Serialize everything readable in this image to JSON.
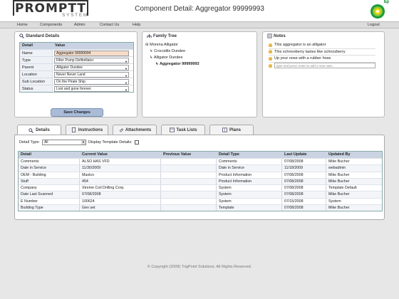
{
  "header": {
    "logo_main": "PROMPTT",
    "logo_sub": "SYSTEM",
    "title": "Component Detail: Aggregator 99999993",
    "brand": "bp",
    "colors": {
      "brand_green": "#1a9b3a",
      "brand_yellow": "#f5d400",
      "accent": "#c9d3e2"
    }
  },
  "nav": {
    "items": [
      "Home",
      "Components",
      "Admin",
      "Contact Us",
      "Help"
    ],
    "logout": "Logout"
  },
  "standard_details": {
    "title": "Standard Details",
    "col_detail": "Detail",
    "col_value": "Value",
    "rows": [
      {
        "label": "Name",
        "value": "Aggregator 99999994"
      },
      {
        "label": "Type",
        "value": "Filter Pump Defibrillator"
      },
      {
        "label": "Parent",
        "value": "Alligator Dundee"
      },
      {
        "label": "Location",
        "value": "Never Never Land"
      },
      {
        "label": "Sub Location",
        "value": "On the Pirate Ship"
      },
      {
        "label": "Status",
        "value": "Lost and gone forever."
      }
    ],
    "save_label": "Save Changes"
  },
  "family_tree": {
    "title": "Family Tree",
    "nodes": [
      "Morena Alligator",
      "Crocodile Dundee",
      "Alligator Dundee",
      "Aggregator 99999993"
    ]
  },
  "notes": {
    "title": "Notes",
    "items": [
      "This aggregator is an alligator",
      "This schnooberry tastes like schnozberry",
      "Up your nose with a rubber hose"
    ],
    "input_placeholder": "type and press enter to add a new note..."
  },
  "tabs": [
    "Details",
    "Instructions",
    "Attachments",
    "Task Lists",
    "Plans"
  ],
  "filter": {
    "label": "Detail Type:",
    "selected": "All",
    "template_label": "Display Template Details:"
  },
  "grid": {
    "columns": [
      "Detail",
      "Current Value",
      "Previous Value",
      "Detail Type",
      "Last Update",
      "Updated By"
    ],
    "rows": [
      [
        "Comments",
        "ALSO HAS VFD",
        "",
        "Comments",
        "07/08/2008",
        "Mike Bucher"
      ],
      [
        "Date in Service",
        "11/30/2009",
        "",
        "Date in Service",
        "11/18/2009",
        "webadmin"
      ],
      [
        "OEM - Building",
        "Mastco",
        "",
        "Product Information",
        "07/08/2008",
        "Mike Bucher"
      ],
      [
        "Stuff",
        "454",
        "",
        "Product Information",
        "07/08/2008",
        "Mike Bucher"
      ],
      [
        "Company",
        "Xtreme Coil Drilling Corp.",
        "",
        "System",
        "07/08/2008",
        "Template Default"
      ],
      [
        "Date Last Scanned",
        "07/08/2008",
        "",
        "System",
        "07/08/2008",
        "Mike Bucher"
      ],
      [
        "E Number",
        "100624",
        "",
        "System",
        "07/15/2008",
        "System"
      ],
      [
        "Building Type",
        "Gen set",
        "",
        "Template",
        "07/08/2008",
        "Mike Bucher"
      ]
    ]
  },
  "footer": "© Copyright (2009) TrigPoint Solutions. All Rights Reserved."
}
